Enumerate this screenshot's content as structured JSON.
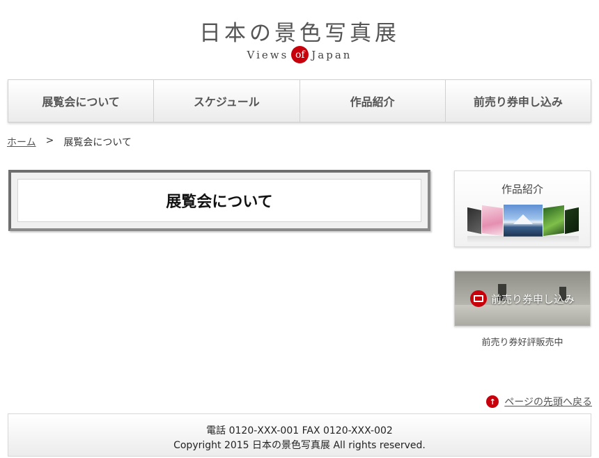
{
  "header": {
    "title": "日本の景色写真展",
    "subtitle_before": "Views",
    "subtitle_of": "of",
    "subtitle_after": "Japan"
  },
  "nav": {
    "items": [
      {
        "label": "展覧会について"
      },
      {
        "label": "スケジュール"
      },
      {
        "label": "作品紹介"
      },
      {
        "label": "前売り券申し込み"
      }
    ]
  },
  "breadcrumb": {
    "home": "ホーム",
    "separator": ">",
    "current": "展覧会について"
  },
  "main": {
    "page_title": "展覧会について"
  },
  "sidebar": {
    "works_label": "作品紹介",
    "ticket_label": "前売り券申し込み",
    "ticket_note": "前売り券好評販売中"
  },
  "pagetop": {
    "icon": "arrow-up-icon",
    "label": "ページの先頭へ戻る"
  },
  "footer": {
    "phone": "電話 0120-XXX-001 FAX 0120-XXX-002",
    "copyright": "Copyright 2015 日本の景色写真展 All rights reserved."
  },
  "colors": {
    "accent": "#c8000b",
    "text": "#333333"
  }
}
